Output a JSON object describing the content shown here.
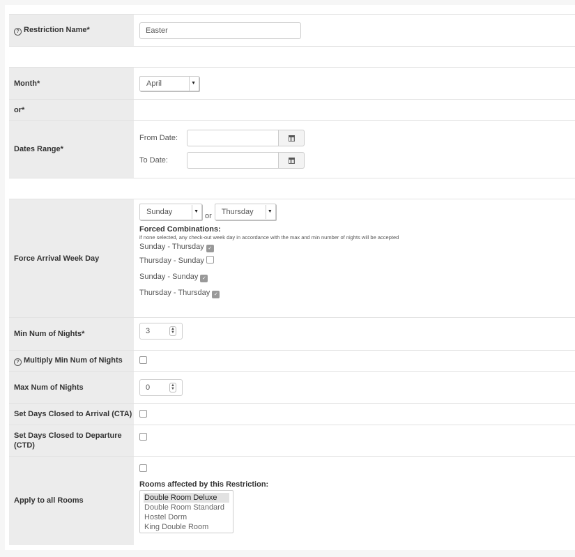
{
  "restriction_name": {
    "label": "Restriction Name*",
    "value": "Easter"
  },
  "month": {
    "label": "Month*",
    "selected": "April"
  },
  "or_label": "or*",
  "dates_range": {
    "label": "Dates Range*",
    "from_label": "From Date:",
    "from_value": "",
    "to_label": "To Date:",
    "to_value": ""
  },
  "force_arrival": {
    "label": "Force Arrival Week Day",
    "day1": "Sunday",
    "or_text": "or",
    "day2": "Thursday",
    "forced_title": "Forced Combinations:",
    "forced_note": "if none selected, any check-out week day in accordance with the max and min number of nights will be accepted",
    "combinations": [
      {
        "label": "Sunday - Thursday",
        "checked": true
      },
      {
        "label": "Thursday - Sunday",
        "checked": false
      },
      {
        "label": "Sunday - Sunday",
        "checked": true
      },
      {
        "label": "Thursday - Thursday",
        "checked": true
      }
    ]
  },
  "min_nights": {
    "label": "Min Num of Nights*",
    "value": "3"
  },
  "multiply_min": {
    "label": "Multiply Min Num of Nights",
    "checked": false
  },
  "max_nights": {
    "label": "Max Num of Nights",
    "value": "0"
  },
  "cta": {
    "label": "Set Days Closed to Arrival (CTA)",
    "checked": false
  },
  "ctd": {
    "label": "Set Days Closed to Departure (CTD)",
    "checked": false
  },
  "apply_all_rooms": {
    "label": "Apply to all Rooms",
    "checked": false,
    "rooms_title": "Rooms affected by this Restriction:",
    "rooms": [
      "Double Room Deluxe",
      "Double Room Standard",
      "Hostel Dorm",
      "King Double Room"
    ],
    "selected_room": "Double Room Deluxe"
  }
}
